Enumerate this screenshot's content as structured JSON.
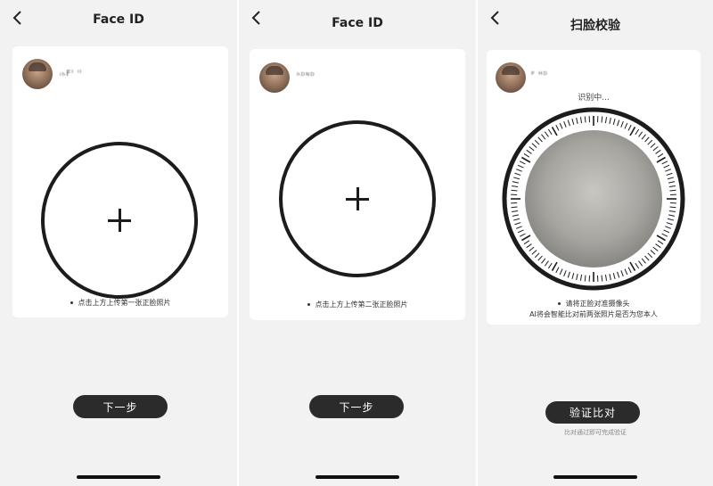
{
  "screen1": {
    "title": "Face ID",
    "back_icon": "chevron-left-icon",
    "user_name": "ᵢₕFᴵ ᴵᴵ",
    "hint": "点击上方上传第一张正脸照片",
    "button_label": "下一步"
  },
  "screen2": {
    "title": "Face ID",
    "back_icon": "chevron-left-icon",
    "user_name": "ʰᴰᴺᴰ",
    "hint": "点击上方上传第二张正脸照片",
    "button_label": "下一步"
  },
  "screen3": {
    "title": "扫脸校验",
    "back_icon": "chevron-left-icon",
    "user_name": "ᴾ ᴴᴰ",
    "status": "识别中...",
    "hint_line1": "请将正脸对准摄像头",
    "hint_line2": "AI将会智能比对前两张照片是否为您本人",
    "button_label": "验证比对",
    "sub_hint": "比对通过即可完成验证"
  },
  "colors": {
    "background": "#f2f2f2",
    "card": "#ffffff",
    "button": "#2b2b2b",
    "ring": "#1c1c1c"
  }
}
